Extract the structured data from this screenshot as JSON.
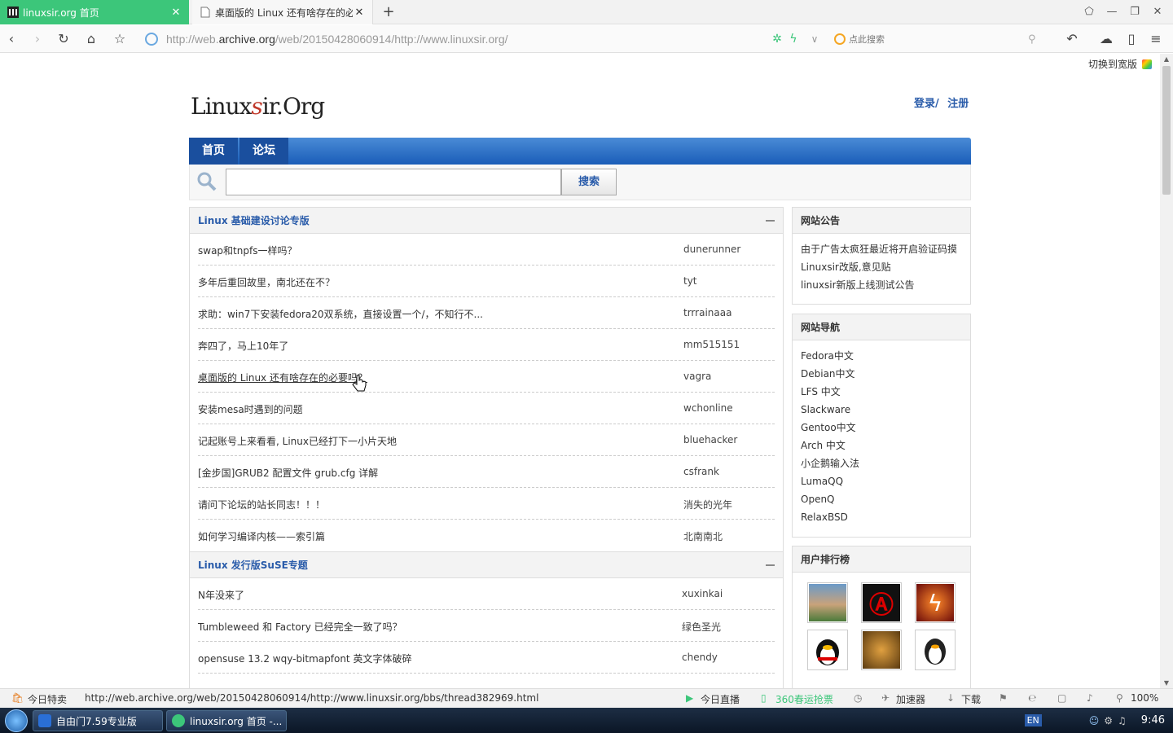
{
  "browser": {
    "tabs": [
      {
        "title": "linuxsir.org 首页",
        "active": true,
        "icon": "bank-icon"
      },
      {
        "title": "桌面版的 Linux 还有啥存在的必要吗？",
        "active": false,
        "icon": "page-icon"
      }
    ],
    "new_tab_label": "+",
    "url_prefix": "http://web.",
    "url_domain": "archive.org",
    "url_rest": "/web/20150428060914/http://www.linuxsir.org/",
    "search_placeholder": "点此搜索",
    "accent": "#3cc67a"
  },
  "page": {
    "wide_toggle": "切换到宽版",
    "logo_pre": "Linux",
    "logo_s": "s",
    "logo_post": "ir.Org",
    "login": "登录/",
    "register": "注册",
    "nav": {
      "home": "首页",
      "forum": "论坛"
    },
    "search_button": "搜索",
    "forums": [
      {
        "title": "Linux 基础建设讨论专版",
        "threads": [
          {
            "title": "swap和tnpfs一样吗？",
            "author": "dunerunner"
          },
          {
            "title": "多年后重回故里，南北还在不？",
            "author": "tyt"
          },
          {
            "title": "求助：win7下安装fedora20双系统，直接设置一个/，不知行不...",
            "author": "trrrainaaa"
          },
          {
            "title": "奔四了，马上10年了",
            "author": "mm515151"
          },
          {
            "title": "桌面版的 Linux 还有啥存在的必要吗？",
            "author": "vagra"
          },
          {
            "title": "安装mesa时遇到的问题",
            "author": "wchonline"
          },
          {
            "title": "记起账号上来看看, Linux已经打下一小片天地",
            "author": "bluehacker"
          },
          {
            "title": "[金步国]GRUB2 配置文件 grub.cfg 详解",
            "author": "csfrank"
          },
          {
            "title": "请问下论坛的站长同志！！！",
            "author": "消失的光年"
          },
          {
            "title": "如何学习编译内核——索引篇",
            "author": "北南南北"
          }
        ]
      },
      {
        "title": "Linux 发行版SuSE专题",
        "threads": [
          {
            "title": "N年没来了",
            "author": "xuxinkai"
          },
          {
            "title": "Tumbleweed 和 Factory 已经完全一致了吗？",
            "author": "绿色圣光"
          },
          {
            "title": "opensuse 13.2 wqy-bitmapfont 英文字体破碎",
            "author": "chendy"
          }
        ]
      }
    ],
    "sidebar": {
      "notice": {
        "title": "网站公告",
        "items": [
          "由于广告太疯狂最近将开启验证码摸",
          "Linuxsir改版,意见贴",
          "linuxsir新版上线测试公告"
        ]
      },
      "links": {
        "title": "网站导航",
        "items": [
          "Fedora中文",
          "Debian中文",
          "LFS 中文",
          "Slackware",
          "Gentoo中文",
          "Arch 中文",
          "小企鹅输入法",
          "LumaQQ",
          "OpenQ",
          "RelaxBSD"
        ]
      },
      "ranking": {
        "title": "用户排行榜",
        "avatars": [
          "avatar-photo-icon",
          "anarchy-icon",
          "lightning-icon",
          "qq-penguin-icon",
          "cat-icon",
          "penguin-icon"
        ]
      }
    }
  },
  "status": {
    "today_deals": "今日特卖",
    "hover_url": "http://web.archive.org/web/20150428060914/http://www.linuxsir.org/bbs/thread382969.html",
    "live": "今日直播",
    "tickets": "360春运抢票",
    "accelerator": "加速器",
    "download": "下载",
    "zoom": "100%"
  },
  "taskbar": {
    "tasks": [
      "自由门7.59专业版",
      "linuxsir.org 首页 -..."
    ],
    "lang": "EN",
    "time": "9:46"
  }
}
